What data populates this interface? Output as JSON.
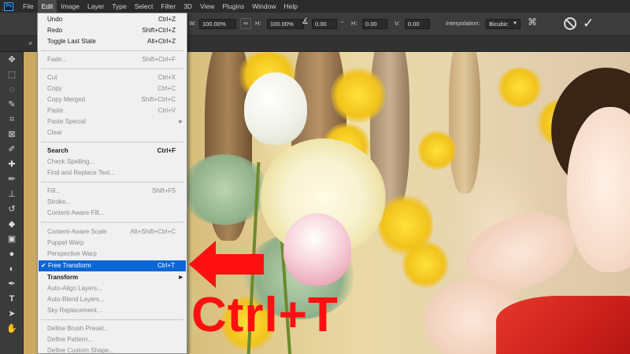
{
  "app": {
    "logo": "Ps"
  },
  "menubar": {
    "items": [
      "File",
      "Edit",
      "Image",
      "Layer",
      "Type",
      "Select",
      "Filter",
      "3D",
      "View",
      "Plugins",
      "Window",
      "Help"
    ],
    "active": "Edit"
  },
  "options": {
    "w_label": "W:",
    "w_value": "100.00%",
    "h_label": "H:",
    "h_value": "100.00%",
    "angle_value": "0.00",
    "hskew_label": "H:",
    "hskew_value": "0.00",
    "vskew_label": "V:",
    "vskew_value": "0.00",
    "interpolation_label": "Interpolation:",
    "interpolation_value": "Bicubic",
    "link_icon": "link-icon",
    "cancel_icon": "cancel-icon",
    "commit_icon": "commit-checkmark-icon"
  },
  "edit_menu": {
    "items": [
      {
        "label": "Undo",
        "shortcut": "Ctrl+Z",
        "disabled": false
      },
      {
        "label": "Redo",
        "shortcut": "Shift+Ctrl+Z",
        "disabled": false
      },
      {
        "label": "Toggle Last State",
        "shortcut": "Alt+Ctrl+Z",
        "disabled": false
      },
      {
        "label": "Fade...",
        "shortcut": "Shift+Ctrl+F",
        "disabled": true
      },
      {
        "label": "Cut",
        "shortcut": "Ctrl+X",
        "disabled": true
      },
      {
        "label": "Copy",
        "shortcut": "Ctrl+C",
        "disabled": true
      },
      {
        "label": "Copy Merged",
        "shortcut": "Shift+Ctrl+C",
        "disabled": true
      },
      {
        "label": "Paste",
        "shortcut": "Ctrl+V",
        "disabled": true
      },
      {
        "label": "Paste Special",
        "shortcut": "",
        "disabled": true,
        "submenu": true
      },
      {
        "label": "Clear",
        "shortcut": "",
        "disabled": true
      },
      {
        "label": "Search",
        "shortcut": "Ctrl+F",
        "disabled": false,
        "bold": true
      },
      {
        "label": "Check Spelling...",
        "shortcut": "",
        "disabled": true
      },
      {
        "label": "Find and Replace Text...",
        "shortcut": "",
        "disabled": true
      },
      {
        "label": "Fill...",
        "shortcut": "Shift+F5",
        "disabled": true
      },
      {
        "label": "Stroke...",
        "shortcut": "",
        "disabled": true
      },
      {
        "label": "Content-Aware Fill...",
        "shortcut": "",
        "disabled": true
      },
      {
        "label": "Content-Aware Scale",
        "shortcut": "Alt+Shift+Ctrl+C",
        "disabled": true
      },
      {
        "label": "Puppet Warp",
        "shortcut": "",
        "disabled": true
      },
      {
        "label": "Perspective Warp",
        "shortcut": "",
        "disabled": true
      },
      {
        "label": "Free Transform",
        "shortcut": "Ctrl+T",
        "disabled": false,
        "highlight": true,
        "checked": true
      },
      {
        "label": "Transform",
        "shortcut": "",
        "disabled": false,
        "bold": true,
        "submenu": true
      },
      {
        "label": "Auto-Align Layers...",
        "shortcut": "",
        "disabled": true
      },
      {
        "label": "Auto-Blend Layers...",
        "shortcut": "",
        "disabled": true
      },
      {
        "label": "Sky Replacement...",
        "shortcut": "",
        "disabled": true
      },
      {
        "label": "Define Brush Preset...",
        "shortcut": "",
        "disabled": true
      },
      {
        "label": "Define Pattern...",
        "shortcut": "",
        "disabled": true
      },
      {
        "label": "Define Custom Shape...",
        "shortcut": "",
        "disabled": true
      }
    ]
  },
  "toolbar": {
    "tools": [
      "move-tool-icon",
      "marquee-tool-icon",
      "lasso-tool-icon",
      "quick-select-tool-icon",
      "crop-tool-icon",
      "frame-tool-icon",
      "eyedropper-tool-icon",
      "healing-brush-icon",
      "brush-tool-icon",
      "clone-stamp-icon",
      "history-brush-icon",
      "eraser-tool-icon",
      "gradient-tool-icon",
      "blur-tool-icon",
      "dodge-tool-icon",
      "pen-tool-icon",
      "type-tool-icon",
      "path-select-icon",
      "hand-tool-icon"
    ]
  },
  "overlay": {
    "shortcut_text": "Ctrl+T",
    "arrow_color": "#ff1010"
  },
  "colors": {
    "menu_highlight": "#0b66d6",
    "menubar_bg": "#2b2b2b",
    "options_bg": "#3c3c3c"
  }
}
